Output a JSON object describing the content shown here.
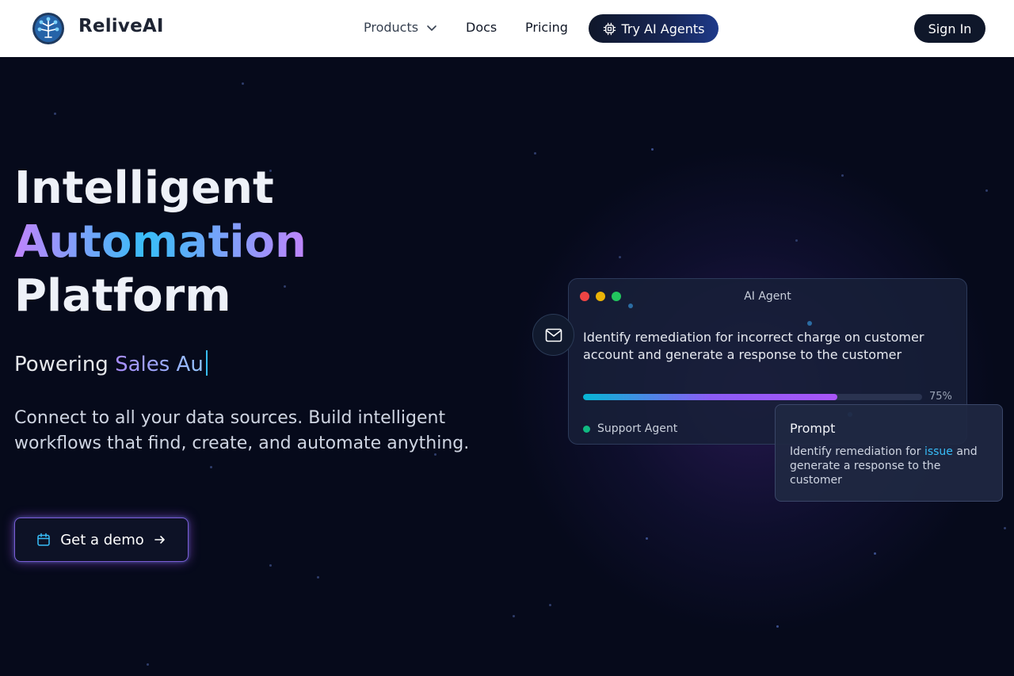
{
  "nav": {
    "brand": "ReliveAI",
    "products_label": "Products",
    "docs_label": "Docs",
    "pricing_label": "Pricing",
    "try_label": "Try AI Agents",
    "signin_label": "Sign In"
  },
  "hero": {
    "headline_line1": "Intelligent",
    "headline_line2": "Automation",
    "headline_line3": "Platform",
    "powering_prefix": "Powering",
    "powering_typed": "Sales Au",
    "description": "Connect to all your data sources. Build intelligent workflows that find, create, and automate anything.",
    "demo_label": "Get a demo"
  },
  "agent_card": {
    "title": "AI Agent",
    "task": "Identify remediation for incorrect charge on customer account and generate a response to the customer",
    "progress": 75,
    "progress_label": "75%",
    "agent_name": "Support Agent"
  },
  "prompt_card": {
    "title": "Prompt",
    "text_before": "Identify remediation for ",
    "highlight": "issue",
    "text_after": " and generate a response to the customer"
  },
  "colors": {
    "accent_purple": "#a855f7",
    "accent_cyan": "#06b6d4",
    "nav_dark": "#0f172a",
    "status_green": "#10b981"
  }
}
